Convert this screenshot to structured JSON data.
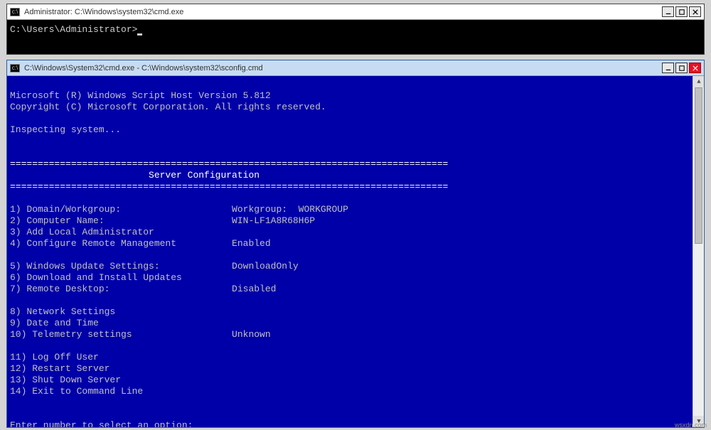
{
  "window1": {
    "title": "Administrator: C:\\Windows\\system32\\cmd.exe",
    "prompt": "C:\\Users\\Administrator>"
  },
  "window2": {
    "title": "C:\\Windows\\System32\\cmd.exe - C:\\Windows\\system32\\sconfig.cmd",
    "line1": "Microsoft (R) Windows Script Host Version 5.812",
    "line2": "Copyright (C) Microsoft Corporation. All rights reserved.",
    "inspecting": "Inspecting system...",
    "rule": "===============================================================================",
    "heading": "                         Server Configuration",
    "menu": {
      "i1": "1) Domain/Workgroup:                    Workgroup:  WORKGROUP",
      "i2": "2) Computer Name:                       WIN-LF1A8R68H6P",
      "i3": "3) Add Local Administrator",
      "i4": "4) Configure Remote Management          Enabled",
      "i5": "5) Windows Update Settings:             DownloadOnly",
      "i6": "6) Download and Install Updates",
      "i7": "7) Remote Desktop:                      Disabled",
      "i8": "8) Network Settings",
      "i9": "9) Date and Time",
      "i10": "10) Telemetry settings                  Unknown",
      "i11": "11) Log Off User",
      "i12": "12) Restart Server",
      "i13": "13) Shut Down Server",
      "i14": "14) Exit to Command Line"
    },
    "prompt": "Enter number to select an option:"
  },
  "watermark": "wsxdn.com"
}
